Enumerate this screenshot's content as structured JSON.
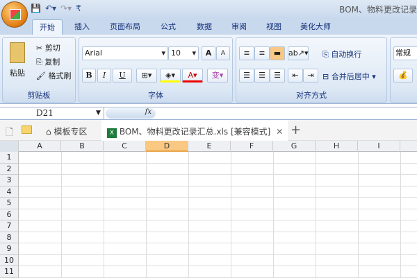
{
  "title_bar": {
    "window_title": "BOM、物料更改记录"
  },
  "ribbon_tabs": [
    "开始",
    "插入",
    "页面布局",
    "公式",
    "数据",
    "审阅",
    "视图",
    "美化大师"
  ],
  "clipboard": {
    "paste": "粘贴",
    "cut": "剪切",
    "copy": "复制",
    "format_painter": "格式刷",
    "label": "剪贴板"
  },
  "font": {
    "name": "Arial",
    "size": "10",
    "bold": "B",
    "italic": "I",
    "underline": "U",
    "grow": "A",
    "shrink": "A",
    "label": "字体",
    "phonetic": "变"
  },
  "alignment": {
    "wrap_text": "自动换行",
    "merge_center": "合并后居中",
    "label": "对齐方式"
  },
  "number": {
    "format": "常规"
  },
  "formula_bar": {
    "name_box": "D21",
    "fx": "fx",
    "value": ""
  },
  "doc_tabs": {
    "templates": "模板专区",
    "file": "BOM、物料更改记录汇总.xls",
    "mode": "[兼容模式]",
    "close": "✕",
    "new": "+"
  },
  "columns": [
    "A",
    "B",
    "C",
    "D",
    "E",
    "F",
    "G",
    "H",
    "I"
  ],
  "selected_column": "D",
  "rows": [
    "1",
    "2",
    "3",
    "4",
    "5",
    "6",
    "7",
    "8",
    "9",
    "10",
    "11"
  ]
}
